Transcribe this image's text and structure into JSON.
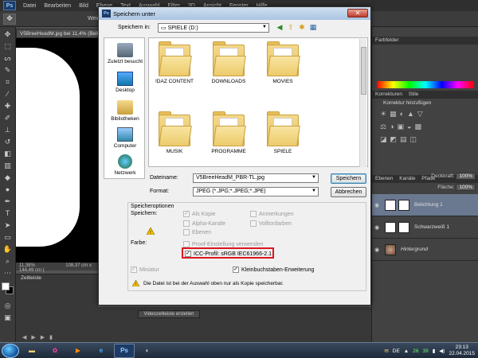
{
  "photoshop": {
    "logo": "Ps",
    "menu": [
      "Datei",
      "Bearbeiten",
      "Bild",
      "Ebene",
      "Text",
      "Auswahl",
      "Filter",
      "3D",
      "Ansicht",
      "Fenster",
      "Hilfe"
    ],
    "options_label": "Weic",
    "doc_tab": "V5BreeHeadM.jpg bei 11,4% (Belic",
    "status_zoom": "11,38%",
    "status_size": "108,37 cm x 144,49 cm (",
    "timeline_tab": "Zeitleiste",
    "video_button": "Videozeitleiste erstellen",
    "panels": {
      "farbfelder": "Farbfelder",
      "korrekturen_tabs": [
        "Korrekturen",
        "Stile"
      ],
      "adjust_title": "Korrektur hinzufügen",
      "layers_tabs": [
        "Ebenen",
        "Kanäle",
        "Pfade"
      ],
      "deckkraft_label": "Deckkraft:",
      "deckkraft_value": "100%",
      "flaeche_label": "Fläche:",
      "flaeche_value": "100%",
      "layers": [
        {
          "name": "Belichtung 1",
          "selected": true
        },
        {
          "name": "Schwarzweiß 1",
          "selected": false
        },
        {
          "name": "Hintergrund",
          "selected": false
        }
      ]
    }
  },
  "dialog": {
    "title": "Speichern unter",
    "close": "✕",
    "save_in_label": "Speichern in:",
    "save_in_value": "SPIELE (D:)",
    "places": [
      "Zuletzt besucht",
      "Desktop",
      "Bibliotheken",
      "Computer",
      "Netzwerk"
    ],
    "folders": [
      "!DAZ CONTENT",
      "DOWNLOADS",
      "MOVIES",
      "MUSIK",
      "PROGRAMME",
      "SPIELE"
    ],
    "filename_label": "Dateiname:",
    "filename_value": "V5BreeHeadM_PBR-TL.jpg",
    "format_label": "Format:",
    "format_value": "JPEG (*.JPG;*.JPEG;*.JPE)",
    "save_button": "Speichern",
    "cancel_button": "Abbrechen",
    "options_title": "Speicheroptionen",
    "speichern_label": "Speichern:",
    "opt_als_kopie": "Als Kopie",
    "opt_anmerkungen": "Anmerkungen",
    "opt_alpha": "Alpha-Kanäle",
    "opt_volltonfarben": "Volltonfarben",
    "opt_ebenen": "Ebenen",
    "farbe_label": "Farbe:",
    "opt_proof": "Proof-Einstellung verwenden",
    "opt_icc": "ICC-Profil: sRGB IEC61966-2.1",
    "opt_miniatur": "Miniatur",
    "opt_kleinbuchstaben": "Kleinbuchstaben-Erweiterung",
    "warning_text": "Die Datei ist bei der Auswahl oben nur als Kopie speicherbar."
  },
  "taskbar": {
    "ps_label": "Ps",
    "tray_lang": "DE",
    "tray_num1": "26",
    "tray_num2": "39",
    "time": "23:13",
    "date": "22.04.2015"
  },
  "colors": {
    "highlight": "#e0141e",
    "selected_layer": "#6a7890"
  }
}
